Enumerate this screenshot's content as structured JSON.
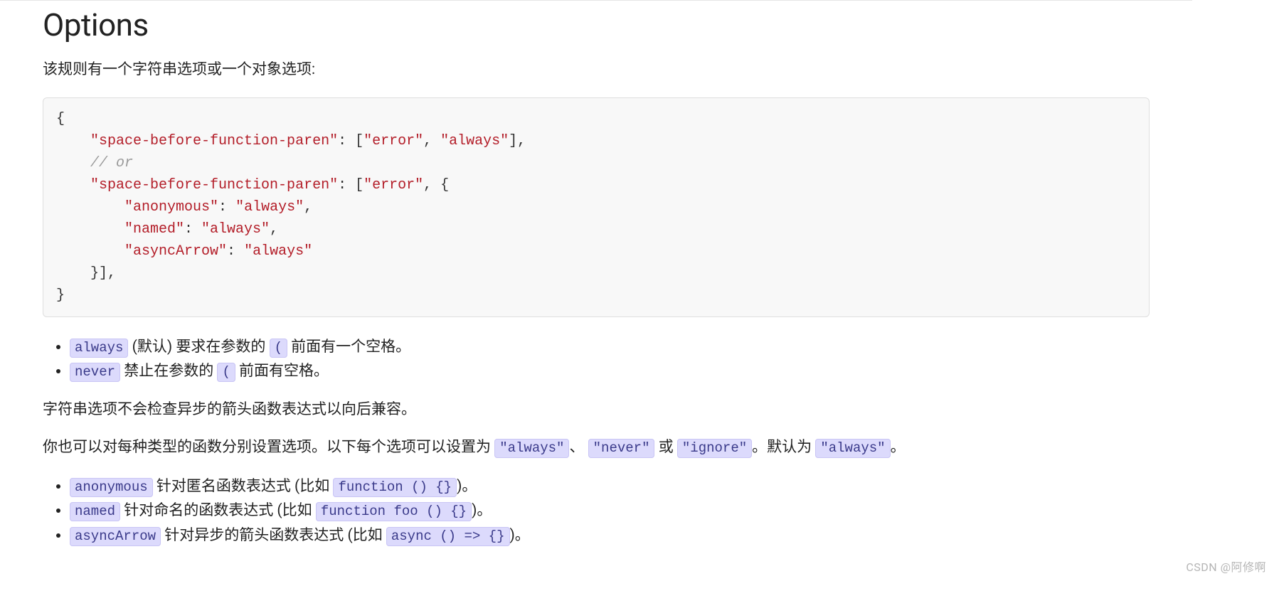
{
  "heading": "Options",
  "intro": "该规则有一个字符串选项或一个对象选项:",
  "code": {
    "key": "\"space-before-function-paren\"",
    "errorVal": "\"error\"",
    "alwaysVal": "\"always\"",
    "orComment": "// or",
    "anonKey": "\"anonymous\"",
    "namedKey": "\"named\"",
    "asyncKey": "\"asyncArrow\""
  },
  "list1": {
    "item1": {
      "code": "always",
      "afterCode": " (默认) 要求在参数的 ",
      "paren": "(",
      "tail": " 前面有一个空格。"
    },
    "item2": {
      "code": "never",
      "afterCode": " 禁止在参数的 ",
      "paren": "(",
      "tail": " 前面有空格。"
    }
  },
  "para2": "字符串选项不会检查异步的箭头函数表达式以向后兼容。",
  "para3": {
    "lead": "你也可以对每种类型的函数分别设置选项。以下每个选项可以设置为 ",
    "opt1": "\"always\"",
    "sep1": "、",
    "opt2": "\"never\"",
    "sep2": " 或 ",
    "opt3": "\"ignore\"",
    "sep3": "。默认为 ",
    "opt4": "\"always\"",
    "end": "。"
  },
  "list2": {
    "item1": {
      "code": "anonymous",
      "mid": " 针对匿名函数表达式 (比如 ",
      "ex": "function () {}",
      "end": ")。"
    },
    "item2": {
      "code": "named",
      "mid": " 针对命名的函数表达式 (比如 ",
      "ex": "function foo () {}",
      "end": ")。"
    },
    "item3": {
      "code": "asyncArrow",
      "mid": " 针对异步的箭头函数表达式 (比如 ",
      "ex": "async () => {}",
      "end": ")。"
    }
  },
  "watermark": "CSDN @阿修啊"
}
